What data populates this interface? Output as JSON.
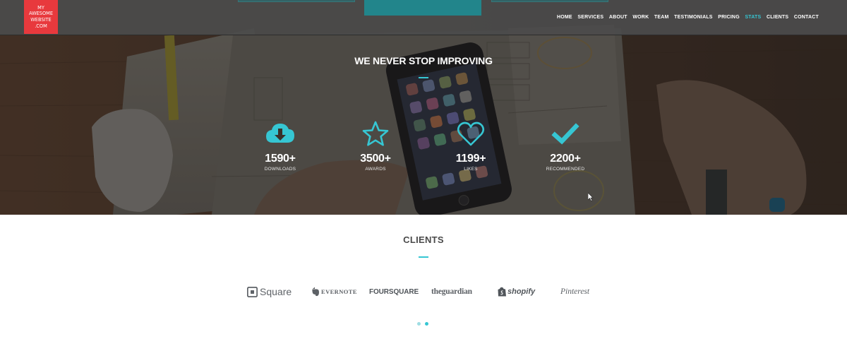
{
  "brand": {
    "logo_lines": [
      "MY",
      "AWESOME",
      "WEBSITE",
      ".COM"
    ],
    "logo_color": "#e8393d"
  },
  "nav": {
    "items": [
      "HOME",
      "SERVICES",
      "ABOUT",
      "WORK",
      "TEAM",
      "TESTIMONIALS",
      "PRICING",
      "STATS",
      "CLIENTS",
      "CONTACT"
    ],
    "active": "STATS",
    "active_color": "#36c6d3"
  },
  "stats": {
    "title": "WE NEVER STOP IMPROVING",
    "items": [
      {
        "icon": "cloud-download-icon",
        "number": "1590+",
        "label": "DOWNLOADS"
      },
      {
        "icon": "star-icon",
        "number": "3500+",
        "label": "AWARDS"
      },
      {
        "icon": "heart-icon",
        "number": "1199+",
        "label": "LIKES"
      },
      {
        "icon": "check-icon",
        "number": "2200+",
        "label": "RECOMMENDED"
      }
    ]
  },
  "clients": {
    "title": "CLIENTS",
    "logos": [
      {
        "icon": "square-logo-icon",
        "name": "Square"
      },
      {
        "icon": "evernote-logo-icon",
        "name": "EVERNOTE"
      },
      {
        "icon": "foursquare-logo-icon",
        "name": "FOURSQUARE"
      },
      {
        "icon": "guardian-logo-icon",
        "name": "theguardian"
      },
      {
        "icon": "shopify-logo-icon",
        "name": "shopify"
      },
      {
        "icon": "pinterest-logo-icon",
        "name": "Pinterest"
      }
    ],
    "carousel_pages": 2,
    "carousel_active": 2
  },
  "colors": {
    "accent": "#36c6d3",
    "navbar": "#4b4b4b"
  }
}
